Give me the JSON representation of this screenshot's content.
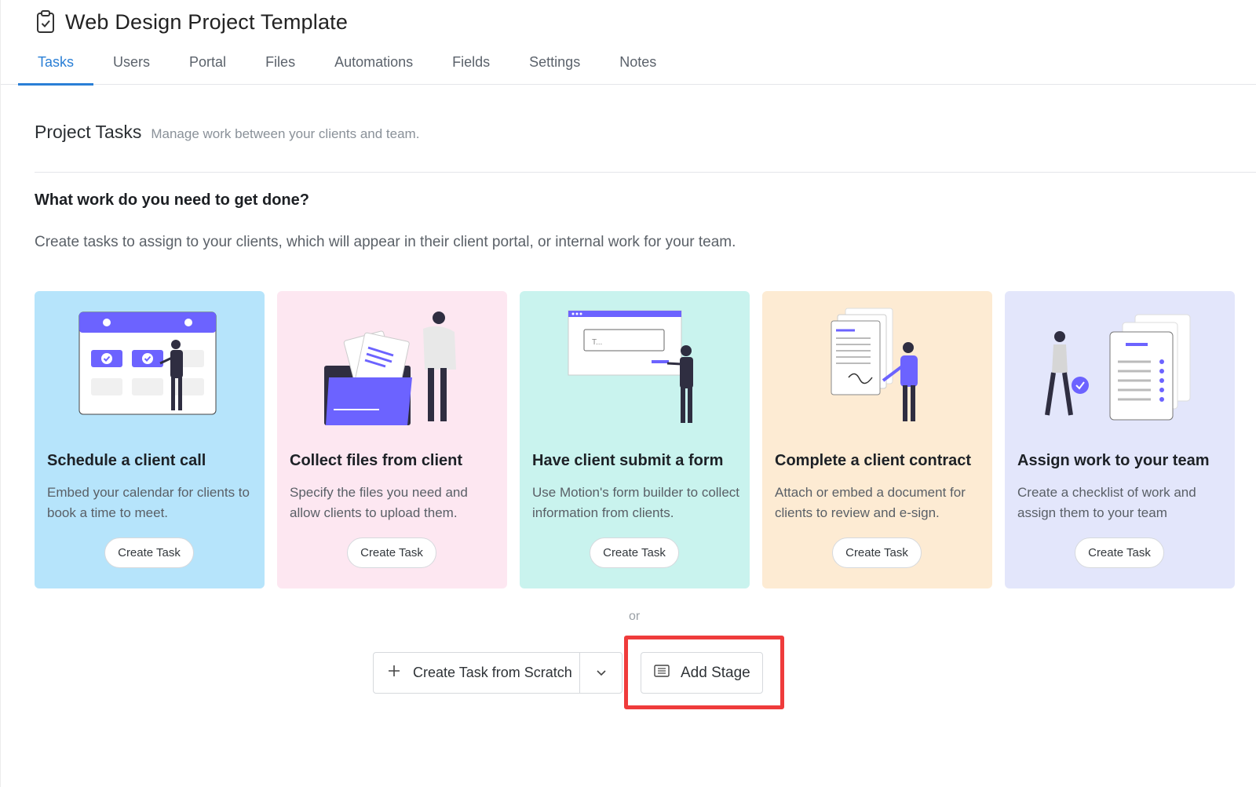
{
  "header": {
    "title": "Web Design Project Template",
    "icon": "clipboard-check-icon"
  },
  "tabs": [
    {
      "label": "Tasks",
      "active": true
    },
    {
      "label": "Users"
    },
    {
      "label": "Portal"
    },
    {
      "label": "Files"
    },
    {
      "label": "Automations"
    },
    {
      "label": "Fields"
    },
    {
      "label": "Settings"
    },
    {
      "label": "Notes"
    }
  ],
  "section": {
    "title": "Project Tasks",
    "subtitle": "Manage work between your clients and team."
  },
  "prompt": {
    "heading": "What work do you need to get done?",
    "description": "Create tasks to assign to your clients, which will appear in their client portal, or internal work for your team."
  },
  "cards": [
    {
      "title": "Schedule a client call",
      "description": "Embed your calendar for clients to book a time to meet.",
      "button": "Create Task",
      "bg": "#b6e4fb",
      "illustration": "calendar-illustration"
    },
    {
      "title": "Collect files from client",
      "description": "Specify the files you need and allow clients to upload them.",
      "button": "Create Task",
      "bg": "#fde7f1",
      "illustration": "folder-files-illustration"
    },
    {
      "title": "Have client submit a form",
      "description": "Use Motion's form builder to collect information from clients.",
      "button": "Create Task",
      "bg": "#c9f3ee",
      "illustration": "form-window-illustration"
    },
    {
      "title": "Complete a client contract",
      "description": "Attach or embed a document for clients to review and e-sign.",
      "button": "Create Task",
      "bg": "#fdebd3",
      "illustration": "contract-sign-illustration"
    },
    {
      "title": "Assign work to your team",
      "description": "Create a checklist of work and assign them to your team",
      "button": "Create Task",
      "bg": "#e3e6fb",
      "illustration": "checklist-illustration"
    }
  ],
  "form_placeholder": "T...",
  "divider_text": "or",
  "actions": {
    "create_scratch": "Create Task from Scratch",
    "add_stage": "Add Stage"
  },
  "colors": {
    "accent": "#2a7fd6",
    "illustration_purple": "#6c63ff",
    "highlight": "#ef3b3b"
  }
}
